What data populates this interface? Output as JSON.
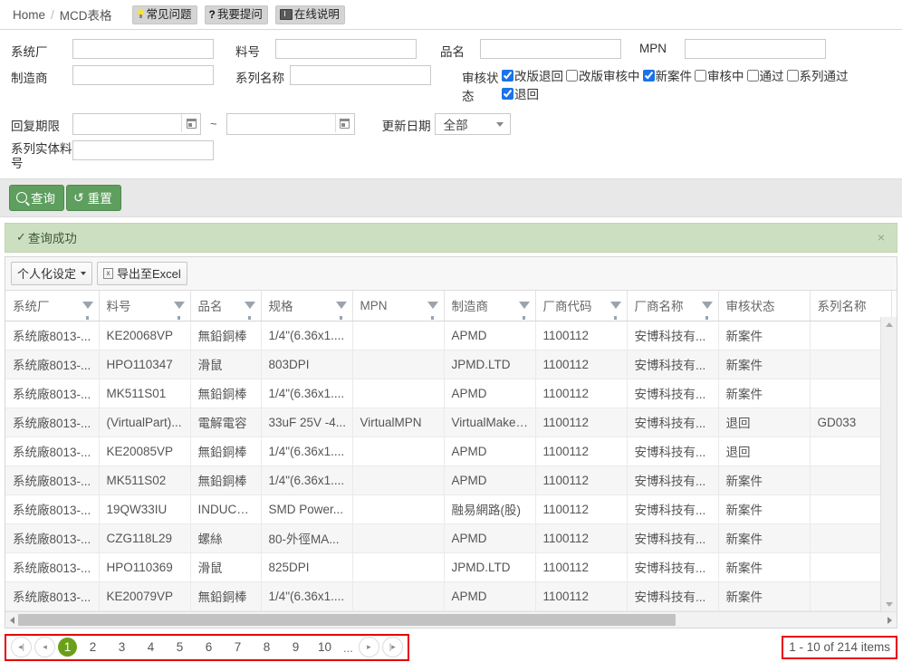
{
  "breadcrumb": {
    "home": "Home",
    "separator": "/",
    "current": "MCD表格"
  },
  "help_buttons": [
    {
      "label": "常见问题",
      "icon": "lightbulb-icon"
    },
    {
      "label": "我要提问",
      "icon": "question-mark-icon"
    },
    {
      "label": "在线说明",
      "icon": "book-icon"
    }
  ],
  "search_form": {
    "system_factory": {
      "label": "系统厂",
      "value": "",
      "placeholder": ""
    },
    "part_number": {
      "label": "料号",
      "value": "",
      "placeholder": ""
    },
    "product_name": {
      "label": "品名",
      "value": "",
      "placeholder": ""
    },
    "mpn": {
      "label": "MPN",
      "value": "",
      "placeholder": ""
    },
    "manufacturer": {
      "label": "制造商",
      "value": "",
      "placeholder": ""
    },
    "series_name": {
      "label": "系列名称",
      "value": "",
      "placeholder": ""
    },
    "review_status": {
      "label": "审核状态",
      "options": [
        {
          "label": "改版退回",
          "checked": true
        },
        {
          "label": "改版审核中",
          "checked": false
        },
        {
          "label": "新案件",
          "checked": true
        },
        {
          "label": "审核中",
          "checked": false
        },
        {
          "label": "通过",
          "checked": false
        },
        {
          "label": "系列通过",
          "checked": false
        },
        {
          "label": "退回",
          "checked": true
        }
      ]
    },
    "reply_deadline": {
      "label": "回复期限",
      "from_value": "",
      "to_value": "",
      "range_separator": "~"
    },
    "update_date": {
      "label": "更新日期",
      "selected": "全部"
    },
    "series_entity_part": {
      "label": "系列实体料号",
      "value": "",
      "placeholder": ""
    }
  },
  "actions": {
    "search": "查询",
    "reset": "重置"
  },
  "alert": {
    "message": "查询成功",
    "check_icon": "check-icon",
    "close_icon": "close-icon"
  },
  "grid_toolbar": {
    "personalize": "个人化设定",
    "export_excel": "导出至Excel"
  },
  "table": {
    "columns": [
      {
        "label": "系统厂",
        "filter": true
      },
      {
        "label": "料号",
        "filter": true
      },
      {
        "label": "品名",
        "filter": true
      },
      {
        "label": "规格",
        "filter": true
      },
      {
        "label": "MPN",
        "filter": true
      },
      {
        "label": "制造商",
        "filter": true
      },
      {
        "label": "厂商代码",
        "filter": true
      },
      {
        "label": "厂商名称",
        "filter": true
      },
      {
        "label": "审核状态",
        "filter": false
      },
      {
        "label": "系列名称",
        "filter": false
      }
    ],
    "rows": [
      [
        "系统廠8013-...",
        "KE20068VP",
        "無鉛銅棒",
        "1/4\"(6.36x1....",
        "",
        "APMD",
        "1100112",
        "安博科技有...",
        "新案件",
        ""
      ],
      [
        "系统廠8013-...",
        "HPO110347",
        "滑鼠",
        "803DPI",
        "",
        "JPMD.LTD",
        "1100112",
        "安博科技有...",
        "新案件",
        ""
      ],
      [
        "系统廠8013-...",
        "MK511S01",
        "無鉛銅棒",
        "1/4\"(6.36x1....",
        "",
        "APMD",
        "1100112",
        "安博科技有...",
        "新案件",
        ""
      ],
      [
        "系统廠8013-...",
        "(VirtualPart)...",
        "電解電容",
        "33uF 25V -4...",
        "VirtualMPN",
        "VirtualMaker...",
        "1100112",
        "安博科技有...",
        "退回",
        "GD033"
      ],
      [
        "系统廠8013-...",
        "KE20085VP",
        "無鉛銅棒",
        "1/4\"(6.36x1....",
        "",
        "APMD",
        "1100112",
        "安博科技有...",
        "退回",
        ""
      ],
      [
        "系统廠8013-...",
        "MK511S02",
        "無鉛銅棒",
        "1/4\"(6.36x1....",
        "",
        "APMD",
        "1100112",
        "安博科技有...",
        "新案件",
        ""
      ],
      [
        "系统廠8013-...",
        "19QW33IU",
        "INDUCTOR(...",
        "SMD Power...",
        "",
        "融易網路(股)",
        "1100112",
        "安博科技有...",
        "新案件",
        ""
      ],
      [
        "系统廠8013-...",
        "CZG118L29",
        "螺絲",
        "80-外徑MA...",
        "",
        "APMD",
        "1100112",
        "安博科技有...",
        "新案件",
        ""
      ],
      [
        "系统廠8013-...",
        "HPO110369",
        "滑鼠",
        "825DPI",
        "",
        "JPMD.LTD",
        "1100112",
        "安博科技有...",
        "新案件",
        ""
      ],
      [
        "系统廠8013-...",
        "KE20079VP",
        "無鉛銅棒",
        "1/4\"(6.36x1....",
        "",
        "APMD",
        "1100112",
        "安博科技有...",
        "新案件",
        ""
      ]
    ]
  },
  "pager": {
    "first_icon": "first-page-icon",
    "prev_icon": "prev-page-icon",
    "next_icon": "next-page-icon",
    "last_icon": "last-page-icon",
    "pages": [
      "1",
      "2",
      "3",
      "4",
      "5",
      "6",
      "7",
      "8",
      "9",
      "10"
    ],
    "active_page": "1",
    "ellipsis": "...",
    "items_info": "1 - 10 of 214 items"
  },
  "colors": {
    "accent_green": "#6aa019",
    "button_green": "#5e9e5e",
    "alert_bg": "#cddfc1",
    "link_blue": "#3b73af",
    "highlight_red": "#e60000"
  }
}
